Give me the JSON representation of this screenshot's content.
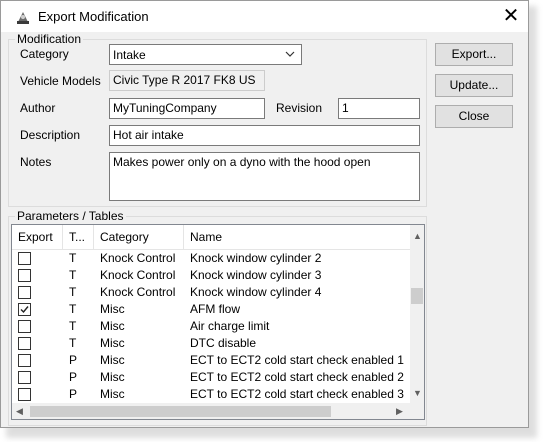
{
  "window": {
    "title": "Export Modification",
    "close_glyph": "✕"
  },
  "modification": {
    "legend": "Modification",
    "category_label": "Category",
    "category_value": "Intake",
    "vehicle_label": "Vehicle Models",
    "vehicle_value": "Civic Type R 2017 FK8 US",
    "author_label": "Author",
    "author_value": "MyTuningCompany",
    "revision_label": "Revision",
    "revision_value": "1",
    "description_label": "Description",
    "description_value": "Hot air intake",
    "notes_label": "Notes",
    "notes_value": "Makes power only on a dyno with the hood open"
  },
  "buttons": {
    "export": "Export...",
    "update": "Update...",
    "close": "Close"
  },
  "parameters": {
    "legend": "Parameters / Tables",
    "columns": [
      "Export",
      "T...",
      "Category",
      "Name"
    ],
    "rows": [
      {
        "checked": false,
        "type": "T",
        "category": "Knock Control",
        "name": "Knock window cylinder 2"
      },
      {
        "checked": false,
        "type": "T",
        "category": "Knock Control",
        "name": "Knock window cylinder 3"
      },
      {
        "checked": false,
        "type": "T",
        "category": "Knock Control",
        "name": "Knock window cylinder 4"
      },
      {
        "checked": true,
        "type": "T",
        "category": "Misc",
        "name": "AFM flow"
      },
      {
        "checked": false,
        "type": "T",
        "category": "Misc",
        "name": "Air charge limit"
      },
      {
        "checked": false,
        "type": "T",
        "category": "Misc",
        "name": "DTC disable"
      },
      {
        "checked": false,
        "type": "P",
        "category": "Misc",
        "name": "ECT to ECT2 cold start check enabled 1"
      },
      {
        "checked": false,
        "type": "P",
        "category": "Misc",
        "name": "ECT to ECT2 cold start check enabled 2"
      },
      {
        "checked": false,
        "type": "P",
        "category": "Misc",
        "name": "ECT to ECT2 cold start check enabled 3"
      }
    ]
  },
  "scrollbars": {
    "up": "▲",
    "down": "▼",
    "left": "◀",
    "right": "▶"
  }
}
